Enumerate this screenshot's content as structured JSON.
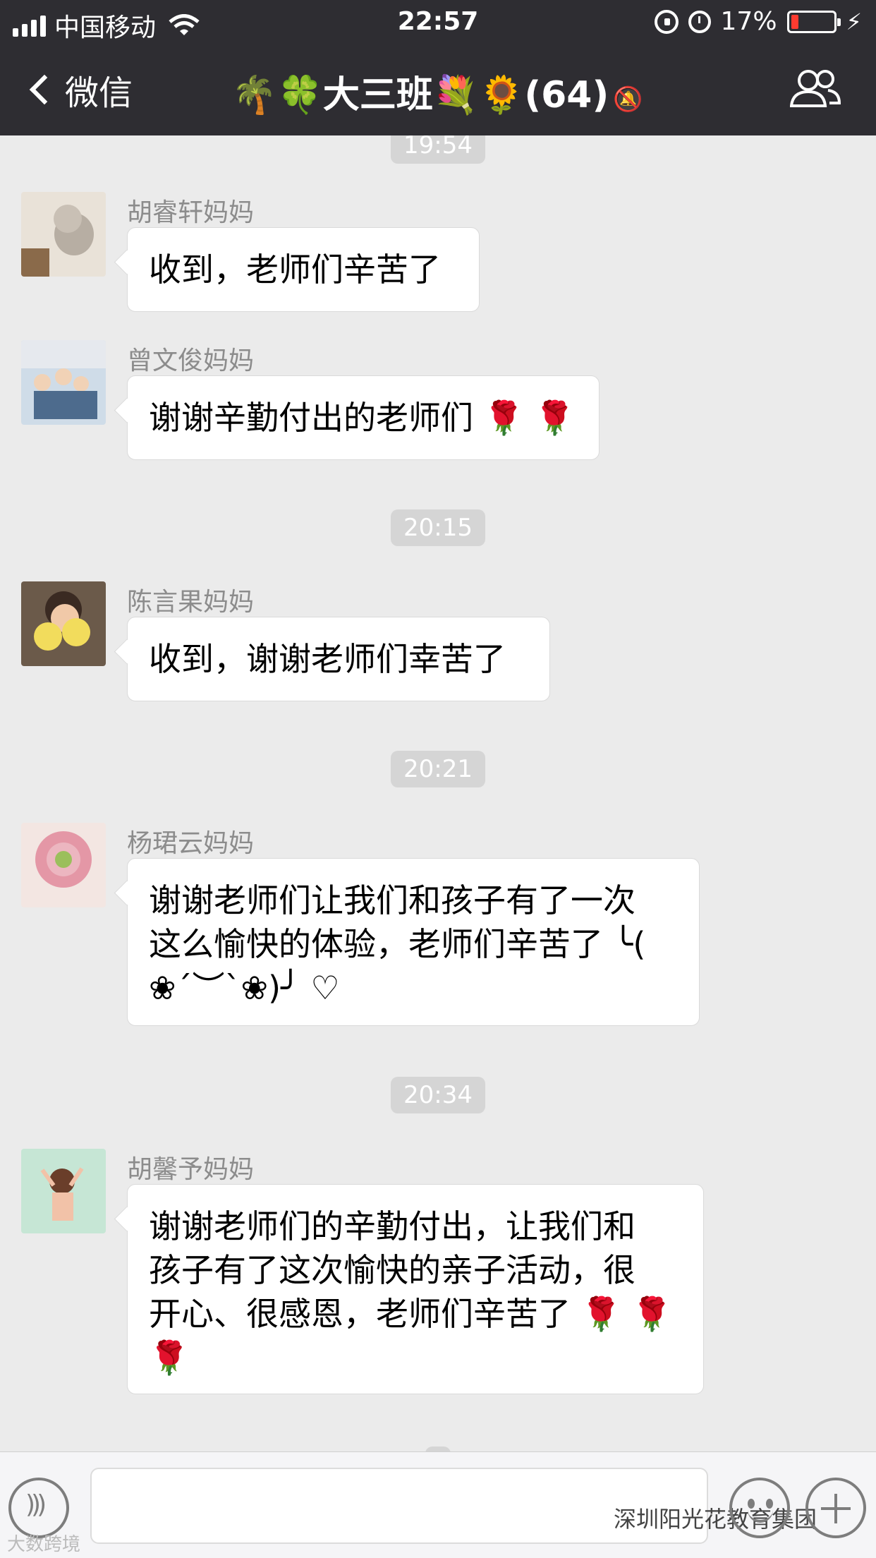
{
  "status_bar": {
    "carrier": "中国移动",
    "time": "22:57",
    "battery": "17%",
    "battery_level": 0.17
  },
  "nav": {
    "back_label": "微信",
    "title": "🌴🍀大三班💐🌻(64)"
  },
  "timestamps": [
    "19:54",
    "20:15",
    "20:21",
    "20:34"
  ],
  "messages": [
    {
      "sender": "胡睿轩妈妈",
      "text": "收到，老师们辛苦了"
    },
    {
      "sender": "曾文俊妈妈",
      "text": "谢谢辛勤付出的老师们",
      "suffix": "🌹 🌹"
    },
    {
      "sender": "陈言果妈妈",
      "text": "收到，谢谢老师们幸苦了"
    },
    {
      "sender": "杨珺云妈妈",
      "line1": "谢谢老师们让我们和孩子有了一次",
      "line2": "这么愉快的体验，老师们辛苦了 ╰(",
      "line3": "❀´︶`❀)╯ ♡"
    },
    {
      "sender": "胡馨予妈妈",
      "line1": "谢谢老师们的辛勤付出，让我们和",
      "line2": "孩子有了这次愉快的亲子活动，很",
      "line3": "开心、很感恩，老师们辛苦了",
      "line3_suffix": "🌹 🌹",
      "line4": "🌹"
    }
  ],
  "watermark": "深圳阳光花教育集团",
  "watermark2": "大数跨境",
  "colors": {
    "nav_bg": "#2e2d32",
    "chat_bg": "#ebebeb",
    "bubble": "#ffffff"
  }
}
